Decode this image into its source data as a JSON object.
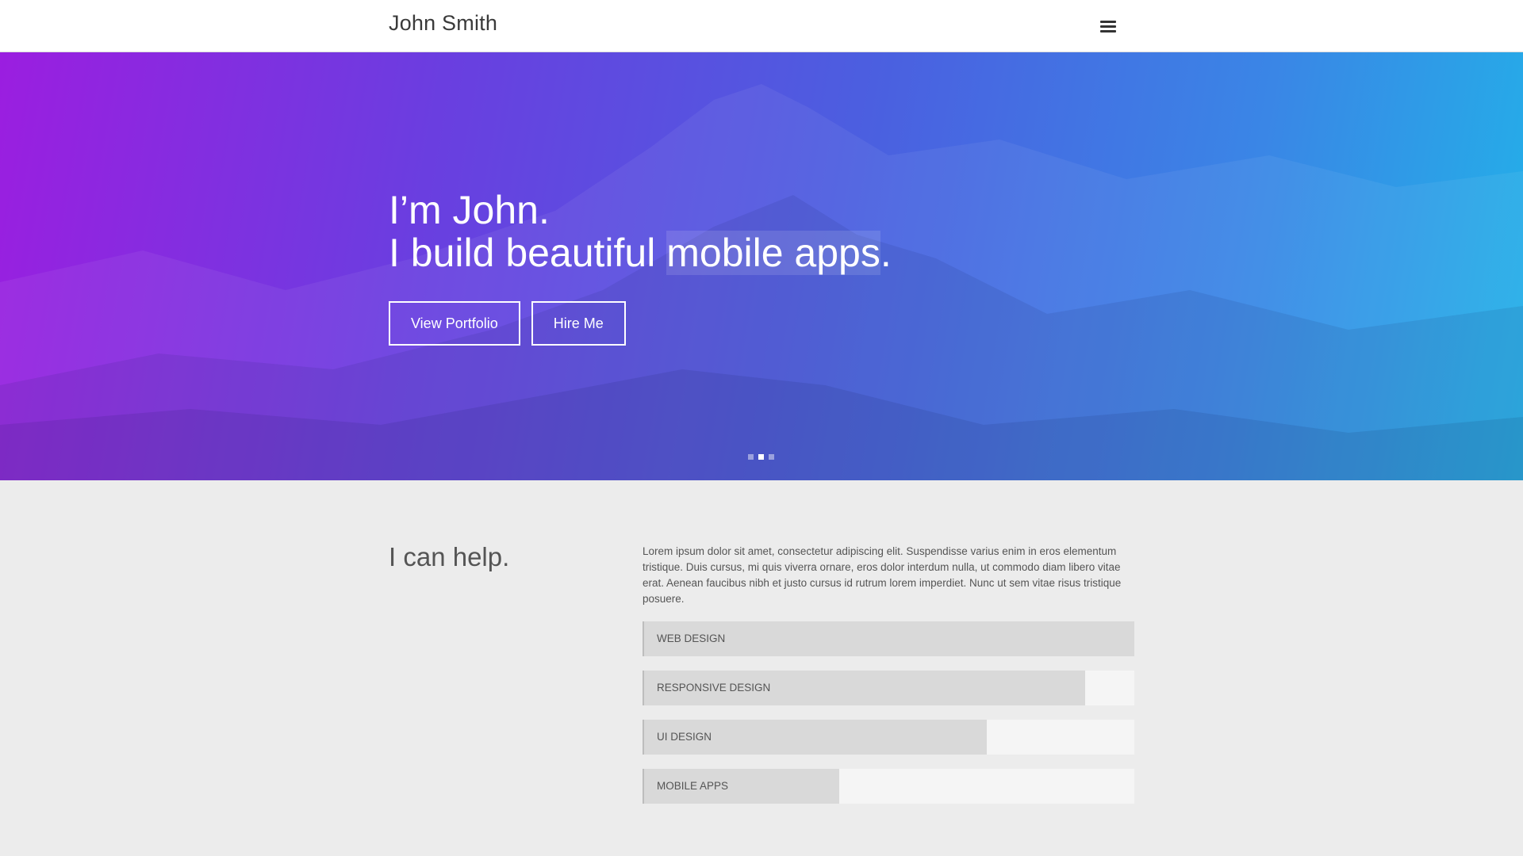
{
  "header": {
    "brand": "John Smith",
    "menu_icon": "hamburger-menu-icon"
  },
  "hero": {
    "headline_line1": "I’m John.",
    "headline_line2_prefix": "I build beautiful ",
    "headline_line2_highlight": "mobile apps",
    "headline_line2_suffix": ".",
    "buttons": {
      "portfolio": "View Portfolio",
      "hire": "Hire Me"
    },
    "carousel": {
      "total": 3,
      "active_index": 1
    },
    "gradient_colors": [
      "#9b1ee0",
      "#6a3ee0",
      "#4b5fe0",
      "#3a86e6",
      "#22b2e8"
    ]
  },
  "help": {
    "title": "I can help.",
    "intro": "Lorem ipsum dolor sit amet, consectetur adipiscing elit. Suspendisse varius enim in eros elementum tristique. Duis cursus, mi quis viverra ornare, eros dolor interdum nulla, ut commodo diam libero vitae erat. Aenean faucibus nibh et justo cursus id rutrum lorem imperdiet. Nunc ut sem vitae risus tristique posuere.",
    "skills": [
      {
        "label": "WEB DESIGN",
        "level": 1.0
      },
      {
        "label": "RESPONSIVE DESIGN",
        "level": 0.9
      },
      {
        "label": "UI DESIGN",
        "level": 0.7
      },
      {
        "label": "MOBILE APPS",
        "level": 0.4
      }
    ]
  }
}
